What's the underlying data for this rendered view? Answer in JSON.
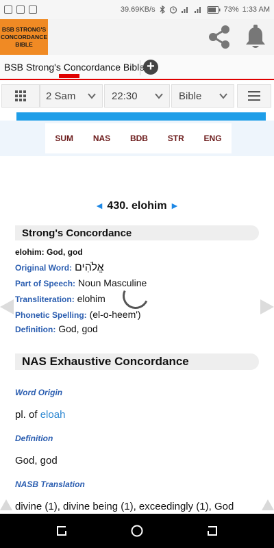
{
  "status_bar": {
    "speed": "39.69KB/s",
    "battery": "73%",
    "time": "1:33 AM"
  },
  "app": {
    "logo_lines": [
      "BSB STRONG'S",
      "CONCORDANCE",
      "BIBLE"
    ]
  },
  "tabbar": {
    "tab_label": "BSB Strong's Concordance Bible",
    "add_label": "+"
  },
  "navbar": {
    "book": "2 Sam",
    "reference": "22:30",
    "version": "Bible"
  },
  "section_tabs": [
    "SUM",
    "NAS",
    "BDB",
    "STR",
    "ENG"
  ],
  "entry": {
    "prev_arrow": "◄",
    "next_arrow": "►",
    "title": "430. elohim"
  },
  "strongs": {
    "heading": "Strong's Concordance",
    "summary": "elohim: God, god",
    "original_word_label": "Original Word:",
    "original_word": "אֱלֹהִים",
    "pos_label": "Part of Speech:",
    "pos": "Noun Masculine",
    "translit_label": "Transliteration:",
    "translit": "elohim",
    "phonetic_label": "Phonetic Spelling:",
    "phonetic": "(el-o-heem')",
    "definition_label": "Definition:",
    "definition": "God, god"
  },
  "nas": {
    "heading": "NAS Exhaustive Concordance",
    "word_origin_label": "Word Origin",
    "word_origin_prefix": "pl. of",
    "word_origin_link": "eloah",
    "definition_label": "Definition",
    "definition": "God, god",
    "translation_label": "NASB Translation",
    "translation": "divine (1), divine being (1), exceedingly (1), God"
  }
}
